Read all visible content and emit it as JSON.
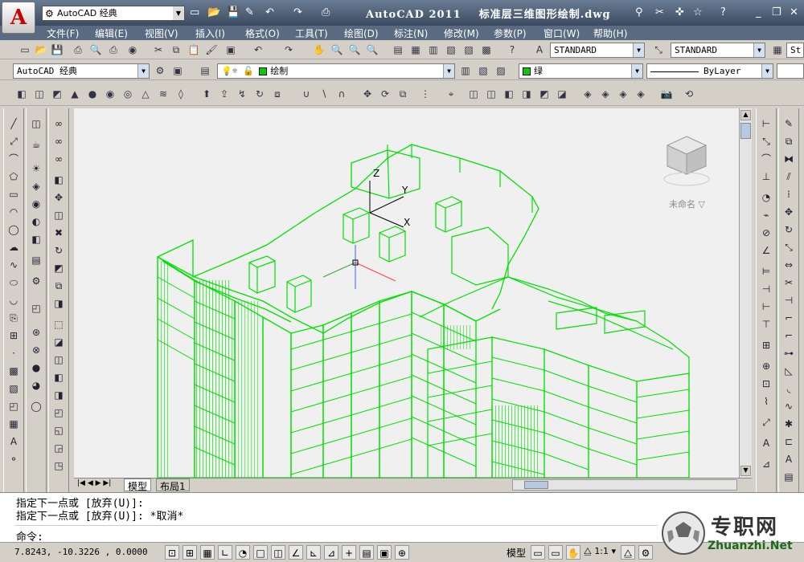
{
  "app": {
    "title": "AutoCAD 2011",
    "document": "标准层三维图形绘制.dwg",
    "workspace": "AutoCAD 经典",
    "app_letter": "A"
  },
  "menu": [
    "文件(F)",
    "编辑(E)",
    "视图(V)",
    "插入(I)",
    "格式(O)",
    "工具(T)",
    "绘图(D)",
    "标注(N)",
    "修改(M)",
    "参数(P)",
    "窗口(W)",
    "帮助(H)"
  ],
  "styles": {
    "text_style": "STANDARD",
    "dim_style": "STANDARD",
    "table_style": "St"
  },
  "layers": {
    "workspace": "AutoCAD 经典",
    "layer": "绘制",
    "color": "绿",
    "linetype": "ByLayer"
  },
  "tabs": {
    "model": "模型",
    "layout": "布局1"
  },
  "command": {
    "line1": "指定下一点或 [放弃(U)]:",
    "line2": "指定下一点或 [放弃(U)]: *取消*",
    "prompt": "命令:"
  },
  "status": {
    "coords": "7.8243,   -10.3226 , 0.0000",
    "model": "模型",
    "scale": "1:1"
  },
  "viewcube": {
    "unnamed": "未命名"
  },
  "axis": {
    "z": "Z",
    "y": "Y",
    "x": "X"
  },
  "watermark": {
    "cn": "专职网",
    "en": "Zhuanzhi.Net"
  },
  "colors": {
    "wire": "#00e000",
    "title_bg": "#3a4a60"
  }
}
